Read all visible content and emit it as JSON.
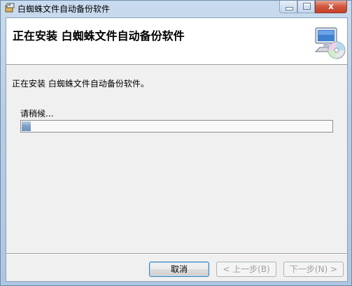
{
  "window": {
    "title": "白蜘蛛文件自动备份软件",
    "close_glyph": "x"
  },
  "header": {
    "title": "正在安装 白蜘蛛文件自动备份软件"
  },
  "main": {
    "status_text": "正在安装 白蜘蛛文件自动备份软件。",
    "wait_label": "请稍候...",
    "progress_fraction": 0.03
  },
  "footer": {
    "cancel_label": "取消",
    "back_label": "< 上一步(B)",
    "next_label": "下一步(N) >"
  },
  "colors": {
    "progress_fill": "#7e9fc6",
    "close_button": "#d2553c",
    "titlebar": "#c9dbee"
  },
  "icons": {
    "app": "installer-package-icon",
    "header": "computer-cd-icon"
  }
}
